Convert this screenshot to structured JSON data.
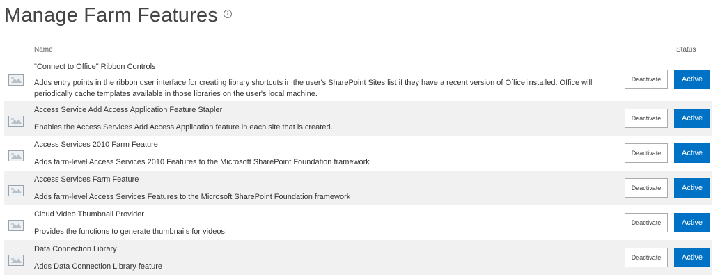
{
  "page": {
    "title": "Manage Farm Features",
    "info_icon": "info-icon"
  },
  "table": {
    "headers": {
      "name": "Name",
      "status": "Status"
    },
    "deactivate_label": "Deactivate",
    "status_label": "Active",
    "features": [
      {
        "title": "\"Connect to Office\" Ribbon Controls",
        "description": "Adds entry points in the ribbon user interface for creating library shortcuts in the user's SharePoint Sites list if they have a recent version of Office installed. Office will periodically cache templates available in those libraries on the user's local machine."
      },
      {
        "title": "Access Service Add Access Application Feature Stapler",
        "description": "Enables the Access Services Add Access Application feature in each site that is created."
      },
      {
        "title": "Access Services 2010 Farm Feature",
        "description": "Adds farm-level Access Services 2010 Features to the Microsoft SharePoint Foundation framework"
      },
      {
        "title": "Access Services Farm Feature",
        "description": "Adds farm-level Access Services Features to the Microsoft SharePoint Foundation framework"
      },
      {
        "title": "Cloud Video Thumbnail Provider",
        "description": "Provides the functions to generate thumbnails for videos."
      },
      {
        "title": "Data Connection Library",
        "description": "Adds Data Connection Library feature"
      }
    ]
  },
  "colors": {
    "accent": "#0072c6",
    "row_alt": "#f1f1f1"
  }
}
